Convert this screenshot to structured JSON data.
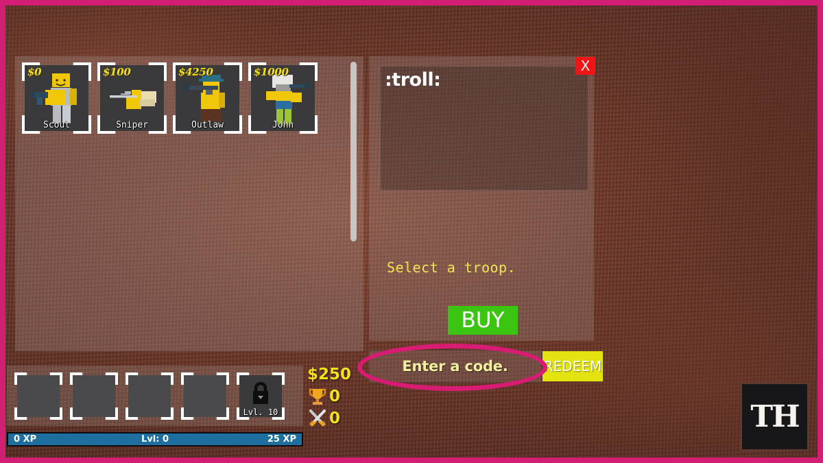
{
  "colors": {
    "highlight_pink": "#d91c73",
    "wood_brown": "#6b3a2c",
    "price_yellow": "#f2e01c",
    "buy_green": "#3bc412",
    "redeem_yellow": "#e3e312",
    "close_red": "#f01414",
    "xp_blue": "#1e6f9e"
  },
  "shop": {
    "troops": [
      {
        "price": "$0",
        "name": "Scout",
        "icon": "scout-figure-icon"
      },
      {
        "price": "$100",
        "name": "Sniper",
        "icon": "sniper-figure-icon"
      },
      {
        "price": "$4250",
        "name": "Outlaw",
        "icon": "outlaw-figure-icon"
      },
      {
        "price": "$1000",
        "name": "John",
        "icon": "john-figure-icon"
      }
    ]
  },
  "info_panel": {
    "description": ":troll:",
    "status_text": "Select a troop.",
    "buy_label": "BUY",
    "close_label": "X"
  },
  "code_entry": {
    "placeholder": "Enter a code.",
    "value": "",
    "redeem_label": "REDEEM"
  },
  "hotbar": {
    "slots": [
      {
        "locked": false,
        "label": ""
      },
      {
        "locked": false,
        "label": ""
      },
      {
        "locked": false,
        "label": ""
      },
      {
        "locked": false,
        "label": ""
      },
      {
        "locked": true,
        "label": "Lvl. 10"
      }
    ]
  },
  "currency": {
    "cash": "$250",
    "trophies": "0",
    "kills": "0"
  },
  "xp": {
    "current": "0 XP",
    "level": "Lvl: 0",
    "next": "25 XP"
  },
  "watermark": {
    "label": "TH"
  }
}
